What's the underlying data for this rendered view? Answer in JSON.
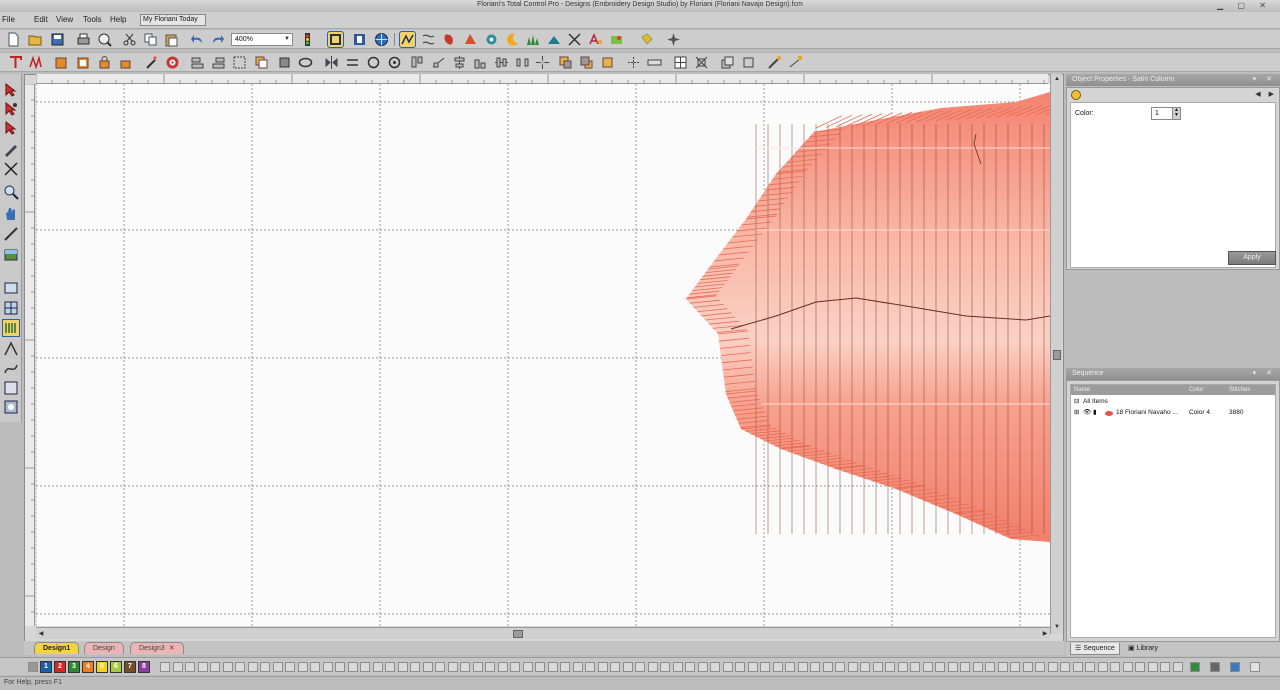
{
  "window": {
    "title": "Floriani's Total Control Pro - Designs (Embroidery Design Studio) by Floriani (Floriani Navajo Design).fcm"
  },
  "menu": {
    "items": [
      "File",
      "Edit",
      "View",
      "Tools",
      "Help"
    ],
    "workspace_combo": "My Floriani Today"
  },
  "toolbar": {
    "zoom": "400%"
  },
  "tabs": [
    {
      "label": "Design1",
      "active": true
    },
    {
      "label": "Design",
      "active": false
    },
    {
      "label": "Design3",
      "active": false
    }
  ],
  "properties_panel": {
    "title": "Object Properties - Satin Column",
    "color_label": "Color:",
    "color_value": "1",
    "apply_label": "Apply"
  },
  "sequence_panel": {
    "title": "Sequence",
    "columns": [
      "Name",
      "Color",
      "Stitches"
    ],
    "rows": [
      {
        "name": "All Items",
        "color": "",
        "stitches": ""
      },
      {
        "name": "18 Floriani Navaho ...",
        "color": "Color 4",
        "stitches": "3880"
      }
    ],
    "tabs": [
      "Sequence",
      "Library"
    ]
  },
  "palette": {
    "swatches": [
      {
        "label": "1",
        "color": "#1d5fa8"
      },
      {
        "label": "2",
        "color": "#d22b26"
      },
      {
        "label": "3",
        "color": "#2d8a33"
      },
      {
        "label": "4",
        "color": "#f07c22"
      },
      {
        "label": "5",
        "color": "#f6d21a"
      },
      {
        "label": "6",
        "color": "#a5c83c"
      },
      {
        "label": "7",
        "color": "#7a4d2a"
      },
      {
        "label": "8",
        "color": "#8a3d9c"
      }
    ]
  },
  "status": {
    "text": "For Help, press F1"
  },
  "colors": {
    "stitch_fill": "#f6a08a",
    "stitch_line": "#7a3f35",
    "active_tab": "#f4d246"
  }
}
